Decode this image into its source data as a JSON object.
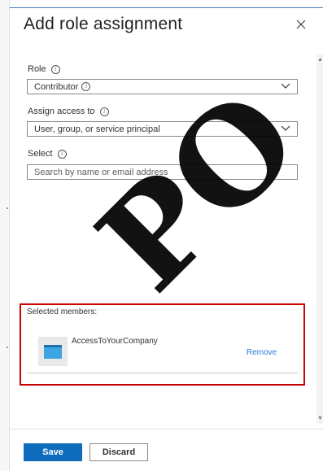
{
  "panel": {
    "title": "Add role assignment"
  },
  "role": {
    "label": "Role",
    "value": "Contributor"
  },
  "assign_access": {
    "label": "Assign access to",
    "value": "User, group, or service principal"
  },
  "select": {
    "label": "Select",
    "placeholder": "Search by name or email address"
  },
  "selected_members": {
    "title": "Selected members:",
    "items": [
      {
        "name": "AccessToYourCompany",
        "action": "Remove"
      }
    ]
  },
  "footer": {
    "save_label": "Save",
    "discard_label": "Discard"
  },
  "watermark": {
    "text": "PO"
  },
  "colors": {
    "accent": "#0f6cbd",
    "link": "#2b7ad6",
    "highlight": "#c70000"
  },
  "icons": {
    "close": "close-icon",
    "info": "info-icon",
    "dropdown": "chevron-down-icon"
  }
}
